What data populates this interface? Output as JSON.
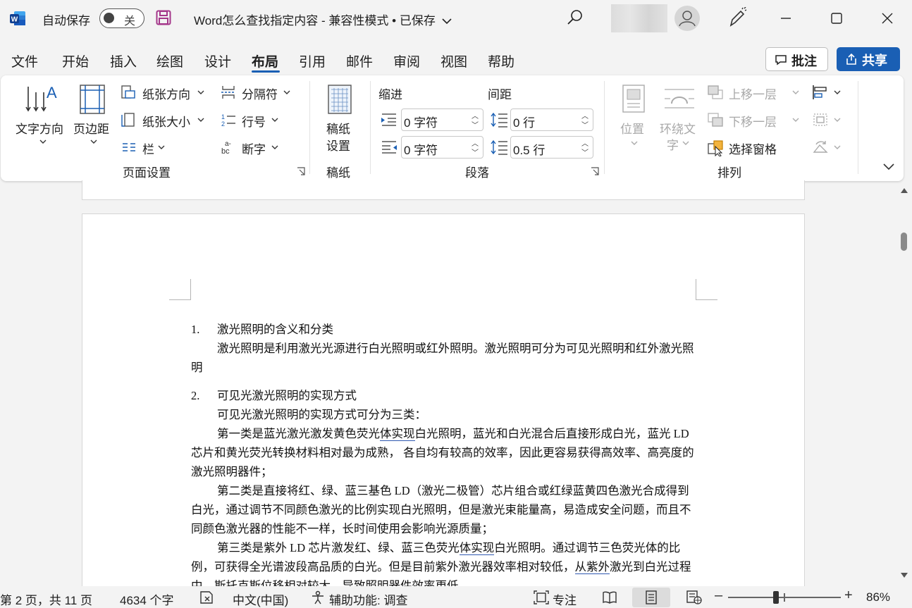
{
  "titlebar": {
    "autosave_label": "自动保存",
    "autosave_state": "关",
    "document_title": "Word怎么查找指定内容  -  兼容性模式 • 已保存",
    "accent_color": "#1a5fb4"
  },
  "tabs": [
    "文件",
    "开始",
    "插入",
    "绘图",
    "设计",
    "布局",
    "引用",
    "邮件",
    "审阅",
    "视图",
    "帮助"
  ],
  "active_tab": "布局",
  "actions": {
    "comment": "批注",
    "share": "共享"
  },
  "ribbon": {
    "page_setup": {
      "text_direction": "文字方向",
      "margins": "页边距",
      "orientation": "纸张方向",
      "size": "纸张大小",
      "columns": "栏",
      "breaks": "分隔符",
      "line_numbers": "行号",
      "hyphenation": "断字",
      "label": "页面设置"
    },
    "manuscript": {
      "button_line1": "稿纸",
      "button_line2": "设置",
      "label": "稿纸"
    },
    "paragraph": {
      "indent_title": "缩进",
      "spacing_title": "间距",
      "indent_left": "0 字符",
      "indent_right": "0 字符",
      "spacing_before": "0 行",
      "spacing_after": "0.5 行",
      "label": "段落"
    },
    "arrange": {
      "position": "位置",
      "wrap_line1": "环绕文",
      "wrap_line2": "字",
      "bring_forward": "上移一层",
      "send_backward": "下移一层",
      "selection_pane": "选择窗格",
      "label": "排列"
    }
  },
  "document": {
    "heading1_num": "1.",
    "heading1": "激光照明的含义和分类",
    "para1": "激光照明是利用激光光源进行白光照明或红外照明。激光照明可分为可见光照明和红外激光照明",
    "heading2_num": "2.",
    "heading2": "可见光激光照明的实现方式",
    "para2": "可见光激光照明的实现方式可分为三类：",
    "para3_a": "第一类是蓝光激光激发黄色荧光",
    "para3_u": "体实现",
    "para3_b": "白光照明，蓝光和白光混合后直接形成白光，蓝光 LD 芯片和黄光荧光转换材料相对最为成熟， 各自均有较高的效率，因此更容易获得高效率、高亮度的激光照明器件；",
    "para4": "第二类是直接将红、绿、蓝三基色  LD（激光二极管）芯片组合或红绿蓝黄四色激光合成得到白光，通过调节不同颜色激光的比例实现白光照明，但是激光束能量高，易造成安全问题，而且不同颜色激光器的性能不一样，长时间使用会影响光源质量；",
    "para5_a": "第三类是紫外 LD 芯片激发红、绿、蓝三色荧光",
    "para5_u1": "体实现",
    "para5_b": "白光照明。通过调节三色荧光体的比例，可获得全光谱波段高品质的白光。但是目前紫外激光器效率相对较低，",
    "para5_u2": "从紫外",
    "para5_c": "激光到白光过程中，斯托克斯位移相对较大，导致照明器件效率更低。"
  },
  "statusbar": {
    "page_info": "第 2 页，共 11 页",
    "word_count": "4634 个字",
    "language": "中文(中国)",
    "accessibility": "辅助功能: 调查",
    "focus": "专注",
    "zoom": "86%",
    "zoom_level": 0.86
  }
}
